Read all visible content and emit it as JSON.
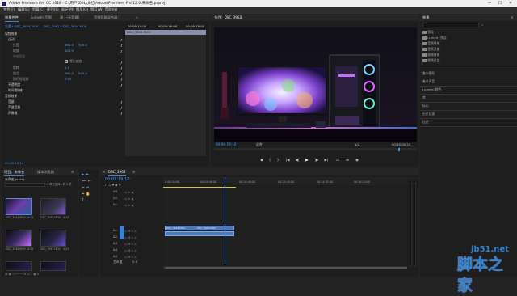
{
  "window": {
    "title": "Adobe Premiere Pro CC 2018 - C:\\用户\\ZOL\\文档\\Adobe\\Premiere Pro\\12.0\\未命名.prproj *",
    "minimize": "—",
    "maximize": "☐",
    "close": "✕"
  },
  "menu": [
    "文件(F)",
    "编辑(E)",
    "剪辑(C)",
    "序列(S)",
    "标记(M)",
    "图形(G)",
    "窗口(W)",
    "帮助(H)"
  ],
  "source_panel": {
    "tabs": [
      "效果控件",
      "Lumetri 范围",
      "源：(无剪辑)",
      "音频剪辑混合器："
    ],
    "menu_glyph": "≡",
    "expand_glyph": "»",
    "header_left": "主要 * DSC_3654.MOV",
    "header_right": "DSC_3962 * DSC_3654.MOV",
    "clip_label": "DSC_3654.MOV",
    "ruler_times": [
      "00:09:14:00",
      "00:09:16:00",
      "00:09:18:00"
    ],
    "sections": {
      "video_effects": "视频效果",
      "motion": "运动",
      "position": "位置",
      "position_x": "960.0",
      "position_y": "540.0",
      "scale": "缩放",
      "scale_val": "100.0",
      "scale_width": "缩放宽度",
      "uniform_scale": "等比缩放",
      "rotation": "旋转",
      "rotation_val": "0.0",
      "anchor": "锚点",
      "anchor_x": "960.0",
      "anchor_y": "540.0",
      "anti_flicker": "防闪烁滤镜",
      "anti_flicker_val": "0.00",
      "opacity": "不透明度",
      "time_remap": "时间重映射",
      "audio_effects": "音频效果",
      "volume": "音量",
      "channel_volume": "声道音量",
      "panner": "声像器"
    },
    "bottom_time": "00:09:19:10"
  },
  "program_monitor": {
    "tab": "节目：DSC_3962",
    "menu_glyph": "≡",
    "timecode": "00:09:19:10",
    "fit": "适合",
    "quality": "1/2",
    "duration": "00:10:00:23",
    "controls": [
      "◆",
      "{",
      "}",
      "|◀",
      "◀|",
      "▶",
      "|▶",
      "▶|",
      "⊡",
      "⊞",
      "◉"
    ]
  },
  "effects_panel": {
    "tab": "效果",
    "menu_glyph": "≡",
    "folders": [
      "预设",
      "Lumetri 预设",
      "音频效果",
      "音频过渡",
      "视频效果",
      "视频过渡"
    ],
    "sections": [
      "基本图形",
      "基本声音",
      "Lumetri 颜色",
      "库",
      "标记",
      "历史记录",
      "信息"
    ]
  },
  "project_panel": {
    "tabs": [
      "项目：未命名",
      "媒体浏览器"
    ],
    "menu_glyph": "≡",
    "project_file": "未命名.prproj",
    "item_count": "1 项已选择，共 9 项",
    "clips": [
      {
        "name": "DSC_3654.MOV",
        "dur": "4:23"
      },
      {
        "name": "DSC_3655.MOV",
        "dur": "4:23"
      },
      {
        "name": "DSC_3656.MOV",
        "dur": "4:23"
      },
      {
        "name": "DSC_3657.MOV",
        "dur": "4:23"
      },
      {
        "name": "DSC_3658.MOV",
        "dur": "4:23"
      },
      {
        "name": "DSC_3659.MOV",
        "dur": "4:23"
      }
    ]
  },
  "tools": [
    "▶",
    "⇹",
    "⟺",
    "↔",
    "✂",
    "⇌",
    "✒",
    "✋",
    "T"
  ],
  "timeline": {
    "tab": "DSC_3962",
    "menu_glyph": "≡",
    "close_glyph": "×",
    "timecode": "00:09:19:10",
    "ruler": [
      "00:00",
      "0:00:56:00",
      "00:09:06:00",
      "00:10:48:00",
      "00:12:40:00",
      "00:14:32:00",
      "00:16:24:00"
    ],
    "video_tracks": [
      "V3",
      "V2",
      "V1"
    ],
    "audio_tracks": [
      "A1",
      "A2",
      "A3",
      "A4",
      "A5"
    ],
    "master": "主声道",
    "master_val": "0.0",
    "clip_label": "DSC_3654.MOV",
    "clip_label_2": "DSC_3655.MOV"
  },
  "watermark": {
    "site": "jb51.net",
    "brand": "脚本之家"
  },
  "colors": {
    "accent_blue": "#3f9bff",
    "playhead": "#4a90e2",
    "clip_blue": "#5f86c7",
    "watermark_blue": "#2b7fd4"
  }
}
